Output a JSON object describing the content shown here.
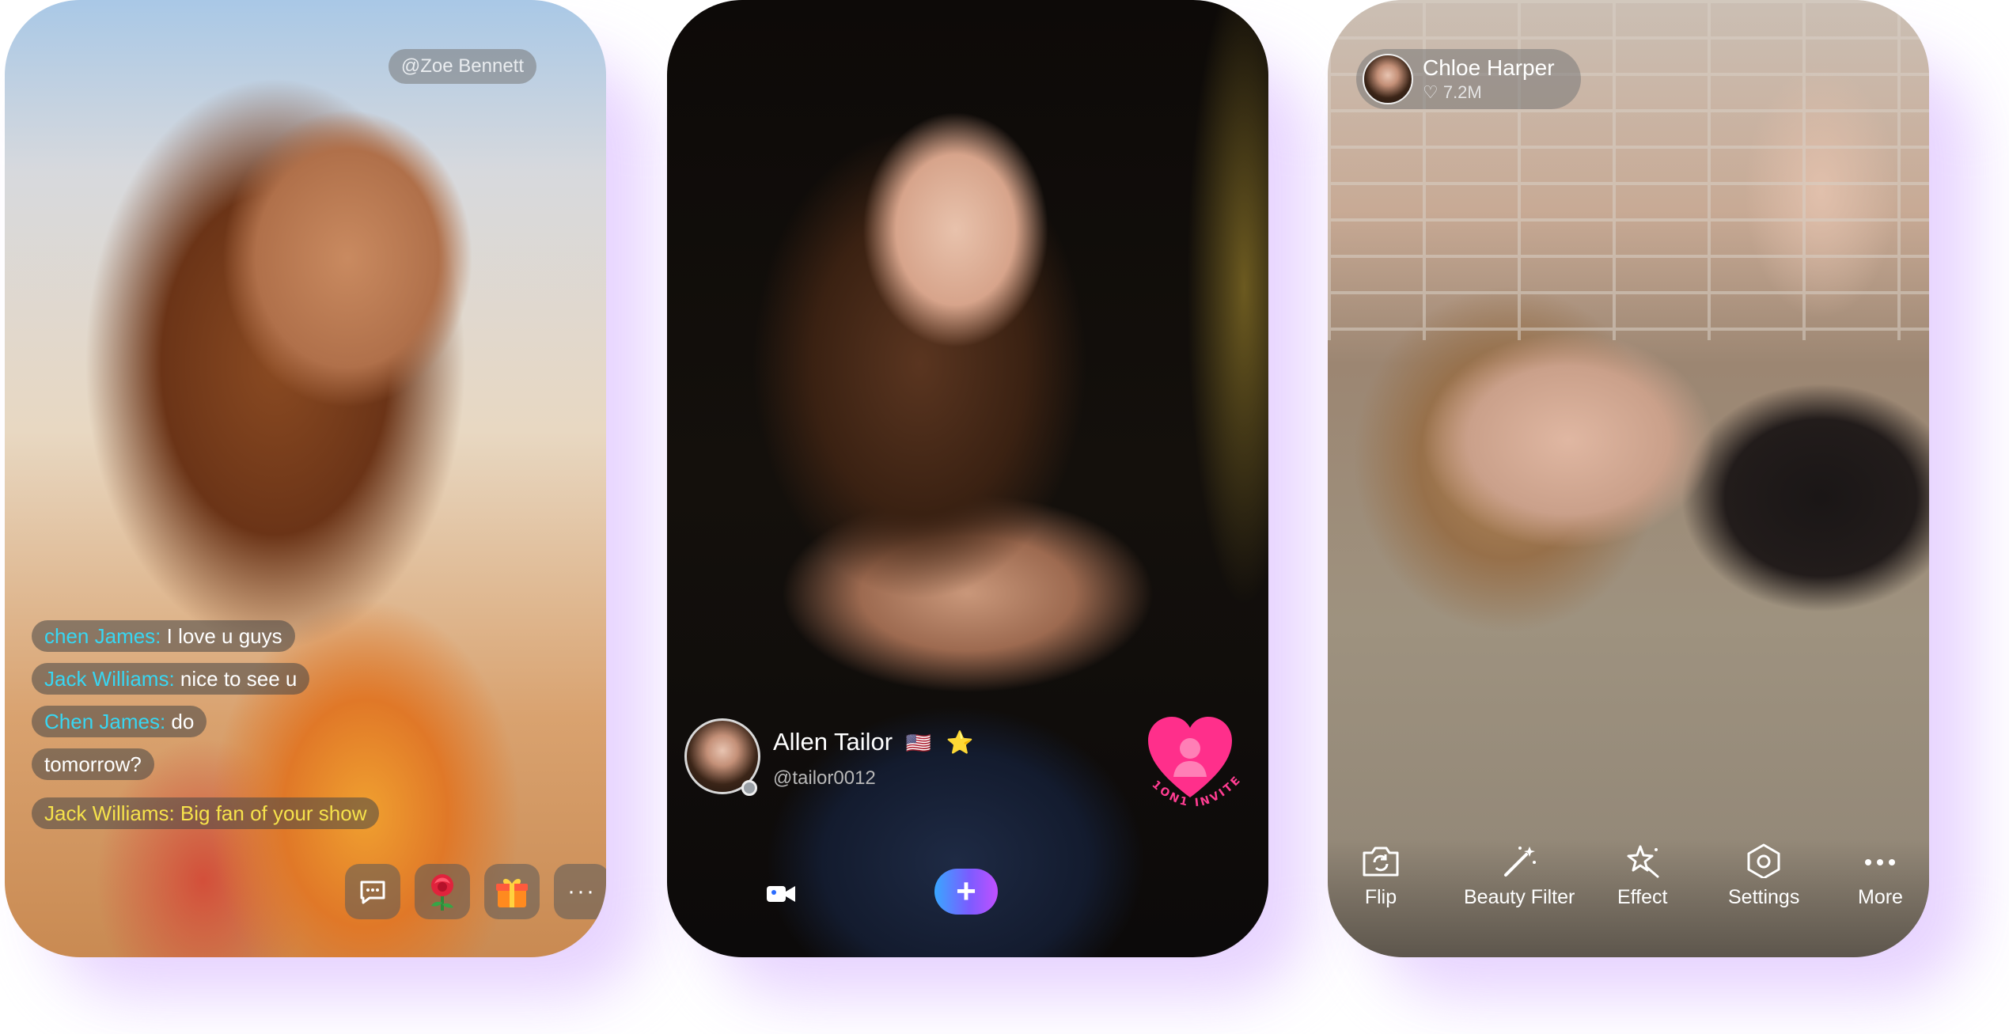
{
  "card1": {
    "username_chip": "@Zoe Bennett",
    "messages": [
      {
        "user": "chen James:",
        "text": "I love u guys",
        "color": "cyan"
      },
      {
        "user": "Jack Williams:",
        "text": "nice to see u",
        "color": "cyan"
      },
      {
        "user": "Chen James:",
        "text": "do",
        "color": "cyan"
      },
      {
        "user": "",
        "text": "tomorrow?",
        "color": "white"
      },
      {
        "user": "Jack Williams:",
        "text": "Big fan of your show",
        "color": "yellow"
      }
    ],
    "buttons": {
      "chat_icon": "chat-bubble-icon",
      "rose_icon": "rose-icon",
      "gift_icon": "gift-icon",
      "more_label": "···"
    }
  },
  "card2": {
    "name": "Allen Tailor",
    "flag": "🇺🇸",
    "badge": "⭐",
    "handle": "@tailor0012",
    "invite_text": "1ON1 INVITE",
    "plus_label": "+"
  },
  "card3": {
    "name": "Chloe Harper",
    "likes": "♡ 7.2M",
    "tools": [
      {
        "label": "Flip",
        "icon": "flip-camera-icon"
      },
      {
        "label": "Beauty Filter",
        "icon": "magic-wand-icon"
      },
      {
        "label": "Effect",
        "icon": "sparkle-star-icon"
      },
      {
        "label": "Settings",
        "icon": "settings-hexagon-icon"
      },
      {
        "label": "More",
        "icon": "more-dots-icon"
      }
    ]
  },
  "colors": {
    "cyan": "#38d6f2",
    "yellow": "#f6e24b",
    "glow": "#e3ccff",
    "accent_gradient": [
      "#39a6ff",
      "#c150ff"
    ],
    "heart": "#ff2f8b"
  }
}
